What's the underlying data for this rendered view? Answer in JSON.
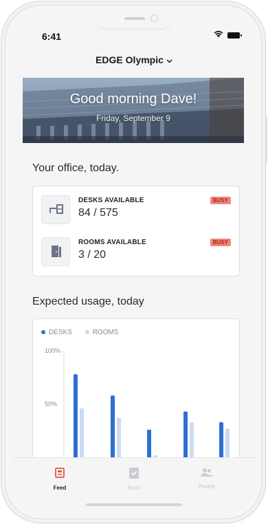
{
  "status_bar": {
    "time": "6:41"
  },
  "header": {
    "location": "EDGE Olympic"
  },
  "hero": {
    "greeting": "Good morning Dave!",
    "date": "Friday, September 9"
  },
  "office": {
    "title": "Your office, today.",
    "desks": {
      "label": "DESKS AVAILABLE",
      "value": "84 / 575",
      "status": "BUSY"
    },
    "rooms": {
      "label": "ROOMS AVAILABLE",
      "value": "3 / 20",
      "status": "BUSY"
    }
  },
  "usage": {
    "title": "Expected usage, today"
  },
  "chart_data": {
    "type": "bar",
    "title": "",
    "series": [
      {
        "name": "DESKS",
        "color": "#2f6fd1",
        "values": [
          78,
          58,
          26,
          43,
          33
        ]
      },
      {
        "name": "ROOMS",
        "color": "#c9dcf3",
        "values": [
          46,
          37,
          2,
          33,
          27
        ]
      }
    ],
    "ylim": [
      0,
      100
    ],
    "yticks": [
      "100%",
      "50%"
    ],
    "legend": "top-left",
    "grid": false
  },
  "tabbar": {
    "feed": "Feed",
    "book": "Book",
    "people": "People",
    "active_color": "#e5533d"
  },
  "icons": [
    "chevron-down-icon",
    "wifi-icon",
    "battery-icon",
    "desk-icon",
    "door-icon",
    "feed-icon",
    "book-icon",
    "people-icon"
  ]
}
